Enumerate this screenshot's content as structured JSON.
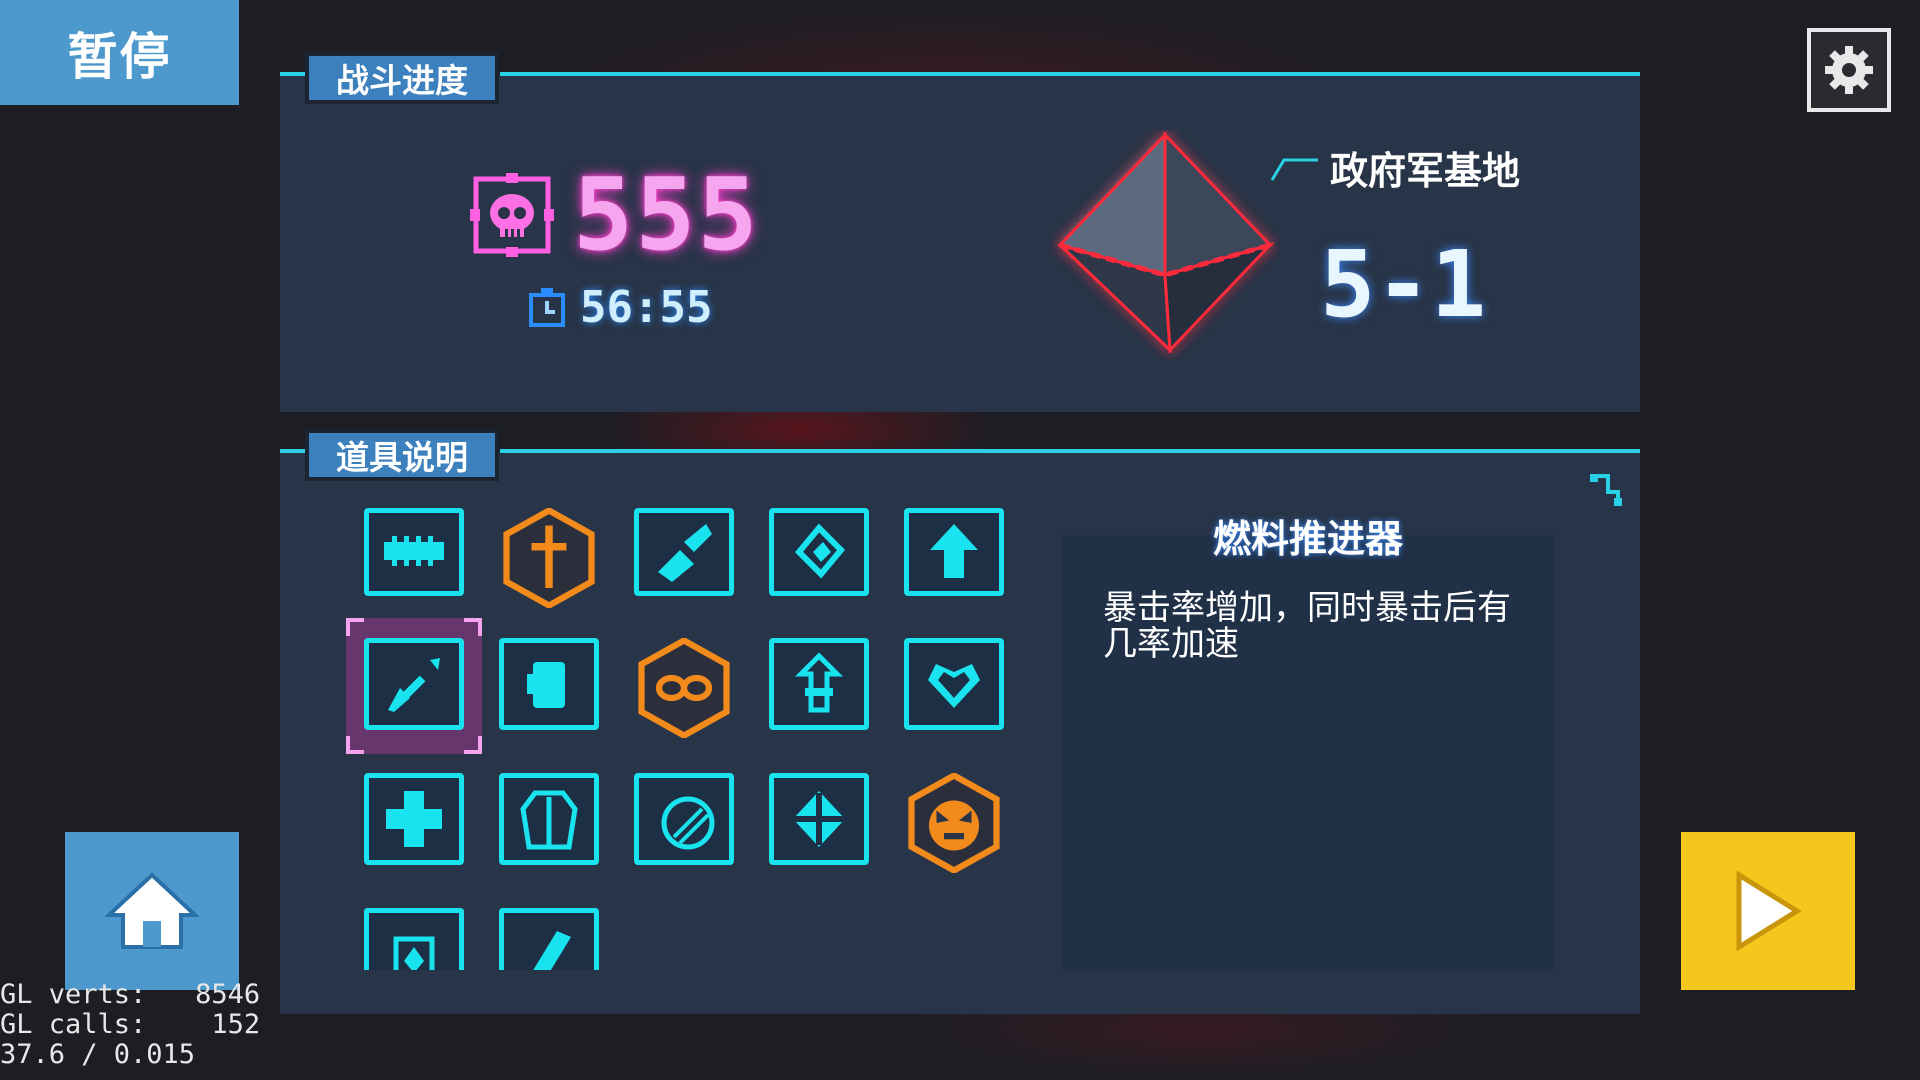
{
  "header": {
    "pause_title": "暂停",
    "settings_icon": "gear-icon"
  },
  "progress_panel": {
    "tab_label": "战斗进度",
    "kill_count": "555",
    "kill_icon": "skull-icon",
    "timer": "56:55",
    "timer_icon": "stopwatch-icon",
    "location_name": "政府军基地",
    "stage": "5-1",
    "crystal_icon": "octahedron-crystal-icon"
  },
  "items_panel": {
    "tab_label": "道具说明",
    "selected_index": 5,
    "items": [
      {
        "icon": "ammo-belt-icon",
        "style": "box"
      },
      {
        "icon": "sword-shield-icon",
        "style": "hex"
      },
      {
        "icon": "flame-cannon-icon",
        "style": "box"
      },
      {
        "icon": "shield-bounce-icon",
        "style": "box"
      },
      {
        "icon": "up-arrow-icon",
        "style": "box"
      },
      {
        "icon": "fuel-thruster-icon",
        "style": "box"
      },
      {
        "icon": "power-fist-icon",
        "style": "box"
      },
      {
        "icon": "infinity-mask-icon",
        "style": "hex"
      },
      {
        "icon": "upgrade-plus-icon",
        "style": "box"
      },
      {
        "icon": "heart-shield-icon",
        "style": "box"
      },
      {
        "icon": "medkit-cross-icon",
        "style": "box"
      },
      {
        "icon": "armor-vest-icon",
        "style": "box"
      },
      {
        "icon": "energy-orb-icon",
        "style": "box"
      },
      {
        "icon": "crosshair-diamond-icon",
        "style": "box"
      },
      {
        "icon": "demon-face-icon",
        "style": "hex"
      },
      {
        "icon": "flame-tank-icon",
        "style": "box"
      },
      {
        "icon": "blade-card-icon",
        "style": "box"
      }
    ],
    "description": {
      "title": "燃料推进器",
      "text": "暴击率增加，同时暴击后有几率加速"
    },
    "collapse_icon": "corner-arrow-icon"
  },
  "footer": {
    "home_icon": "home-icon",
    "play_icon": "play-icon"
  },
  "debug": {
    "line1": "GL verts:   8546",
    "line2": "GL calls:    152",
    "line3": "37.6 / 0.015"
  },
  "colors": {
    "accent_cyan": "#19e3ee",
    "pause_blue": "#4d98cc",
    "play_yellow": "#f5c61b",
    "kill_pink": "#f5a6ee",
    "hex_orange": "#f28a1c"
  }
}
